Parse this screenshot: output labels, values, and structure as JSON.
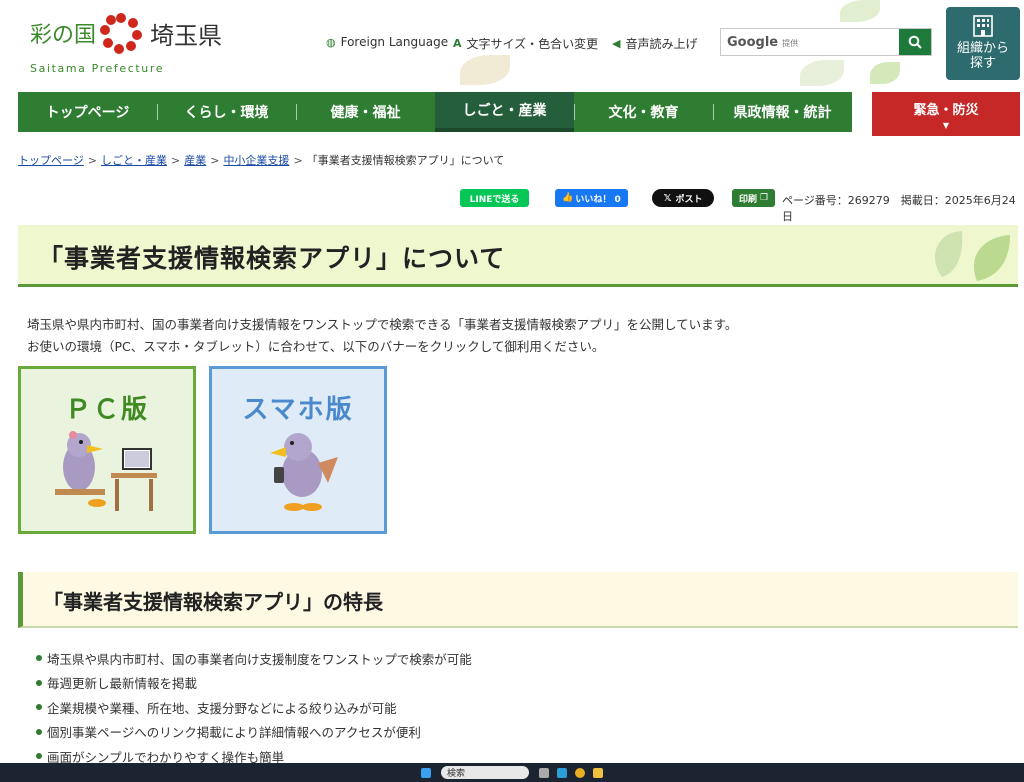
{
  "header": {
    "logo_left": "彩の国",
    "logo_right": "埼玉県",
    "logo_sub": "Saitama Prefecture",
    "foreign_language": "Foreign Language",
    "font_size_color": "文字サイズ・色合い変更",
    "voice_reading": "音声読み上げ",
    "search_label": "Google",
    "search_provided": "提供",
    "search_placeholder": "",
    "org_search_line1": "組織から",
    "org_search_line2": "探す"
  },
  "nav": {
    "items": [
      "トップページ",
      "くらし・環境",
      "健康・福祉",
      "しごと・産業",
      "文化・教育",
      "県政情報・統計"
    ],
    "active": "しごと・産業",
    "emergency": "緊急・防災"
  },
  "breadcrumb": {
    "links": [
      "トップページ",
      "しごと・産業",
      "産業",
      "中小企業支援"
    ],
    "separator": ">",
    "current": "「事業者支援情報検索アプリ」について"
  },
  "share": {
    "line": "LINEで送る",
    "like": "いいね！ 0",
    "post": "ポスト",
    "print": "印刷",
    "page_meta": "ページ番号：269279　掲載日：2025年6月24日"
  },
  "main": {
    "title": "「事業者支援情報検索アプリ」について",
    "lead1": "埼玉県や県内市町村、国の事業者向け支援情報をワンストップで検索できる「事業者支援情報検索アプリ」を公開しています。",
    "lead2": "お使いの環境（PC、スマホ・タブレット）に合わせて、以下のバナーをクリックして御利用ください。",
    "banner_pc": "ＰＣ版",
    "banner_sp": "スマホ版",
    "features_title": "「事業者支援情報検索アプリ」の特長",
    "features": [
      "埼玉県や県内市町村、国の事業者向け支援制度をワンストップで検索が可能",
      "毎週更新し最新情報を掲載",
      "企業規模や業種、所在地、支援分野などによる絞り込みが可能",
      "個別事業ページへのリンク掲載により詳細情報へのアクセスが便利",
      "画面がシンプルでわかりやすく操作も簡単"
    ]
  },
  "taskbar": {
    "search": "検索"
  },
  "colors": {
    "nav_green": "#2e7d32",
    "emergency_red": "#c62828",
    "title_bg": "#eff7cf",
    "org_button": "#2e6b6e"
  }
}
